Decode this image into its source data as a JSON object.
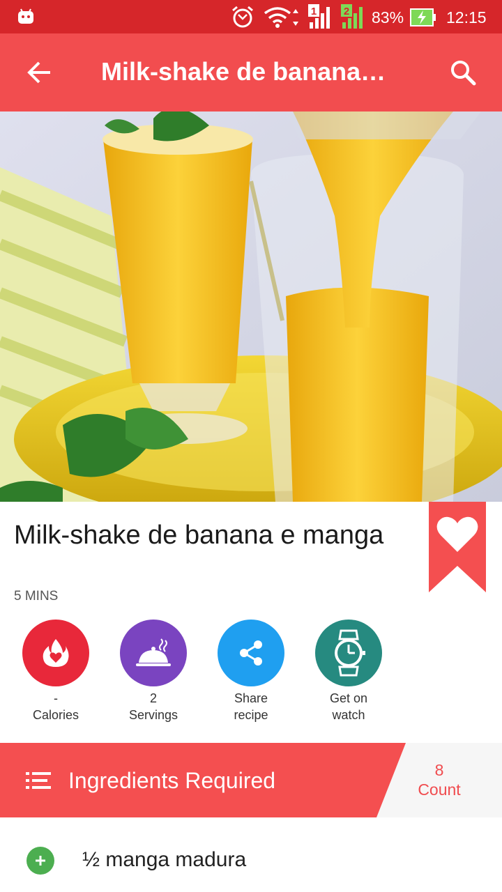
{
  "status_bar": {
    "battery_percent": "83%",
    "time": "12:15",
    "sim1_label": "1",
    "sim2_label": "2"
  },
  "app_bar": {
    "title": "Milk-shake de banana…",
    "back_icon": "arrow-back-icon",
    "search_icon": "search-icon"
  },
  "recipe": {
    "title": "Milk-shake de banana e manga",
    "time": "5 MINS"
  },
  "actions": {
    "calories": {
      "value": "-",
      "label": "Calories",
      "color": "#e8283a"
    },
    "servings": {
      "value": "2",
      "label": "Servings",
      "color": "#7a44c0"
    },
    "share": {
      "line1": "Share",
      "line2": "recipe",
      "color": "#1f9ff0"
    },
    "watch": {
      "line1": "Get on",
      "line2": "watch",
      "color": "#268a80"
    }
  },
  "ingredients": {
    "header": "Ingredients Required",
    "count_value": "8",
    "count_label": "Count",
    "items": [
      {
        "text": "½ manga madura"
      }
    ]
  },
  "colors": {
    "status_bar": "#d6262a",
    "app_bar": "#f24d4f",
    "accent": "#f04c4f",
    "add_green": "#4cae50"
  }
}
